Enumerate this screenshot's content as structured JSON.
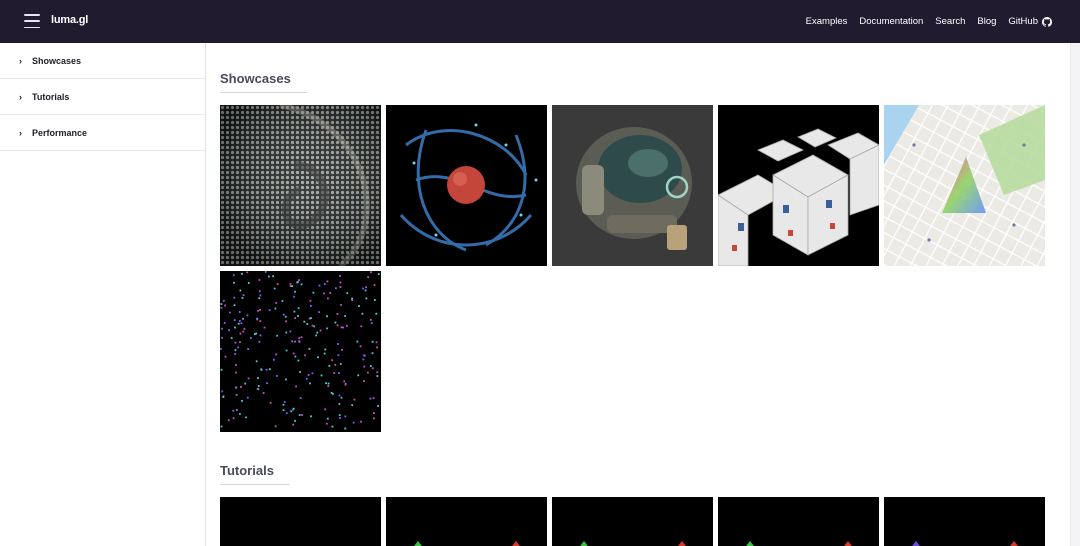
{
  "header": {
    "brand": "luma.gl",
    "nav": [
      {
        "label": "Examples"
      },
      {
        "label": "Documentation"
      },
      {
        "label": "Search"
      },
      {
        "label": "Blog"
      },
      {
        "label": "GitHub"
      }
    ]
  },
  "sidebar": {
    "items": [
      {
        "label": "Showcases"
      },
      {
        "label": "Tutorials"
      },
      {
        "label": "Performance"
      }
    ]
  },
  "main": {
    "sections": [
      {
        "title": "Showcases"
      },
      {
        "title": "Tutorials"
      }
    ]
  },
  "colors": {
    "header_bg": "#201b2e",
    "section_title": "#4a4a5e"
  }
}
